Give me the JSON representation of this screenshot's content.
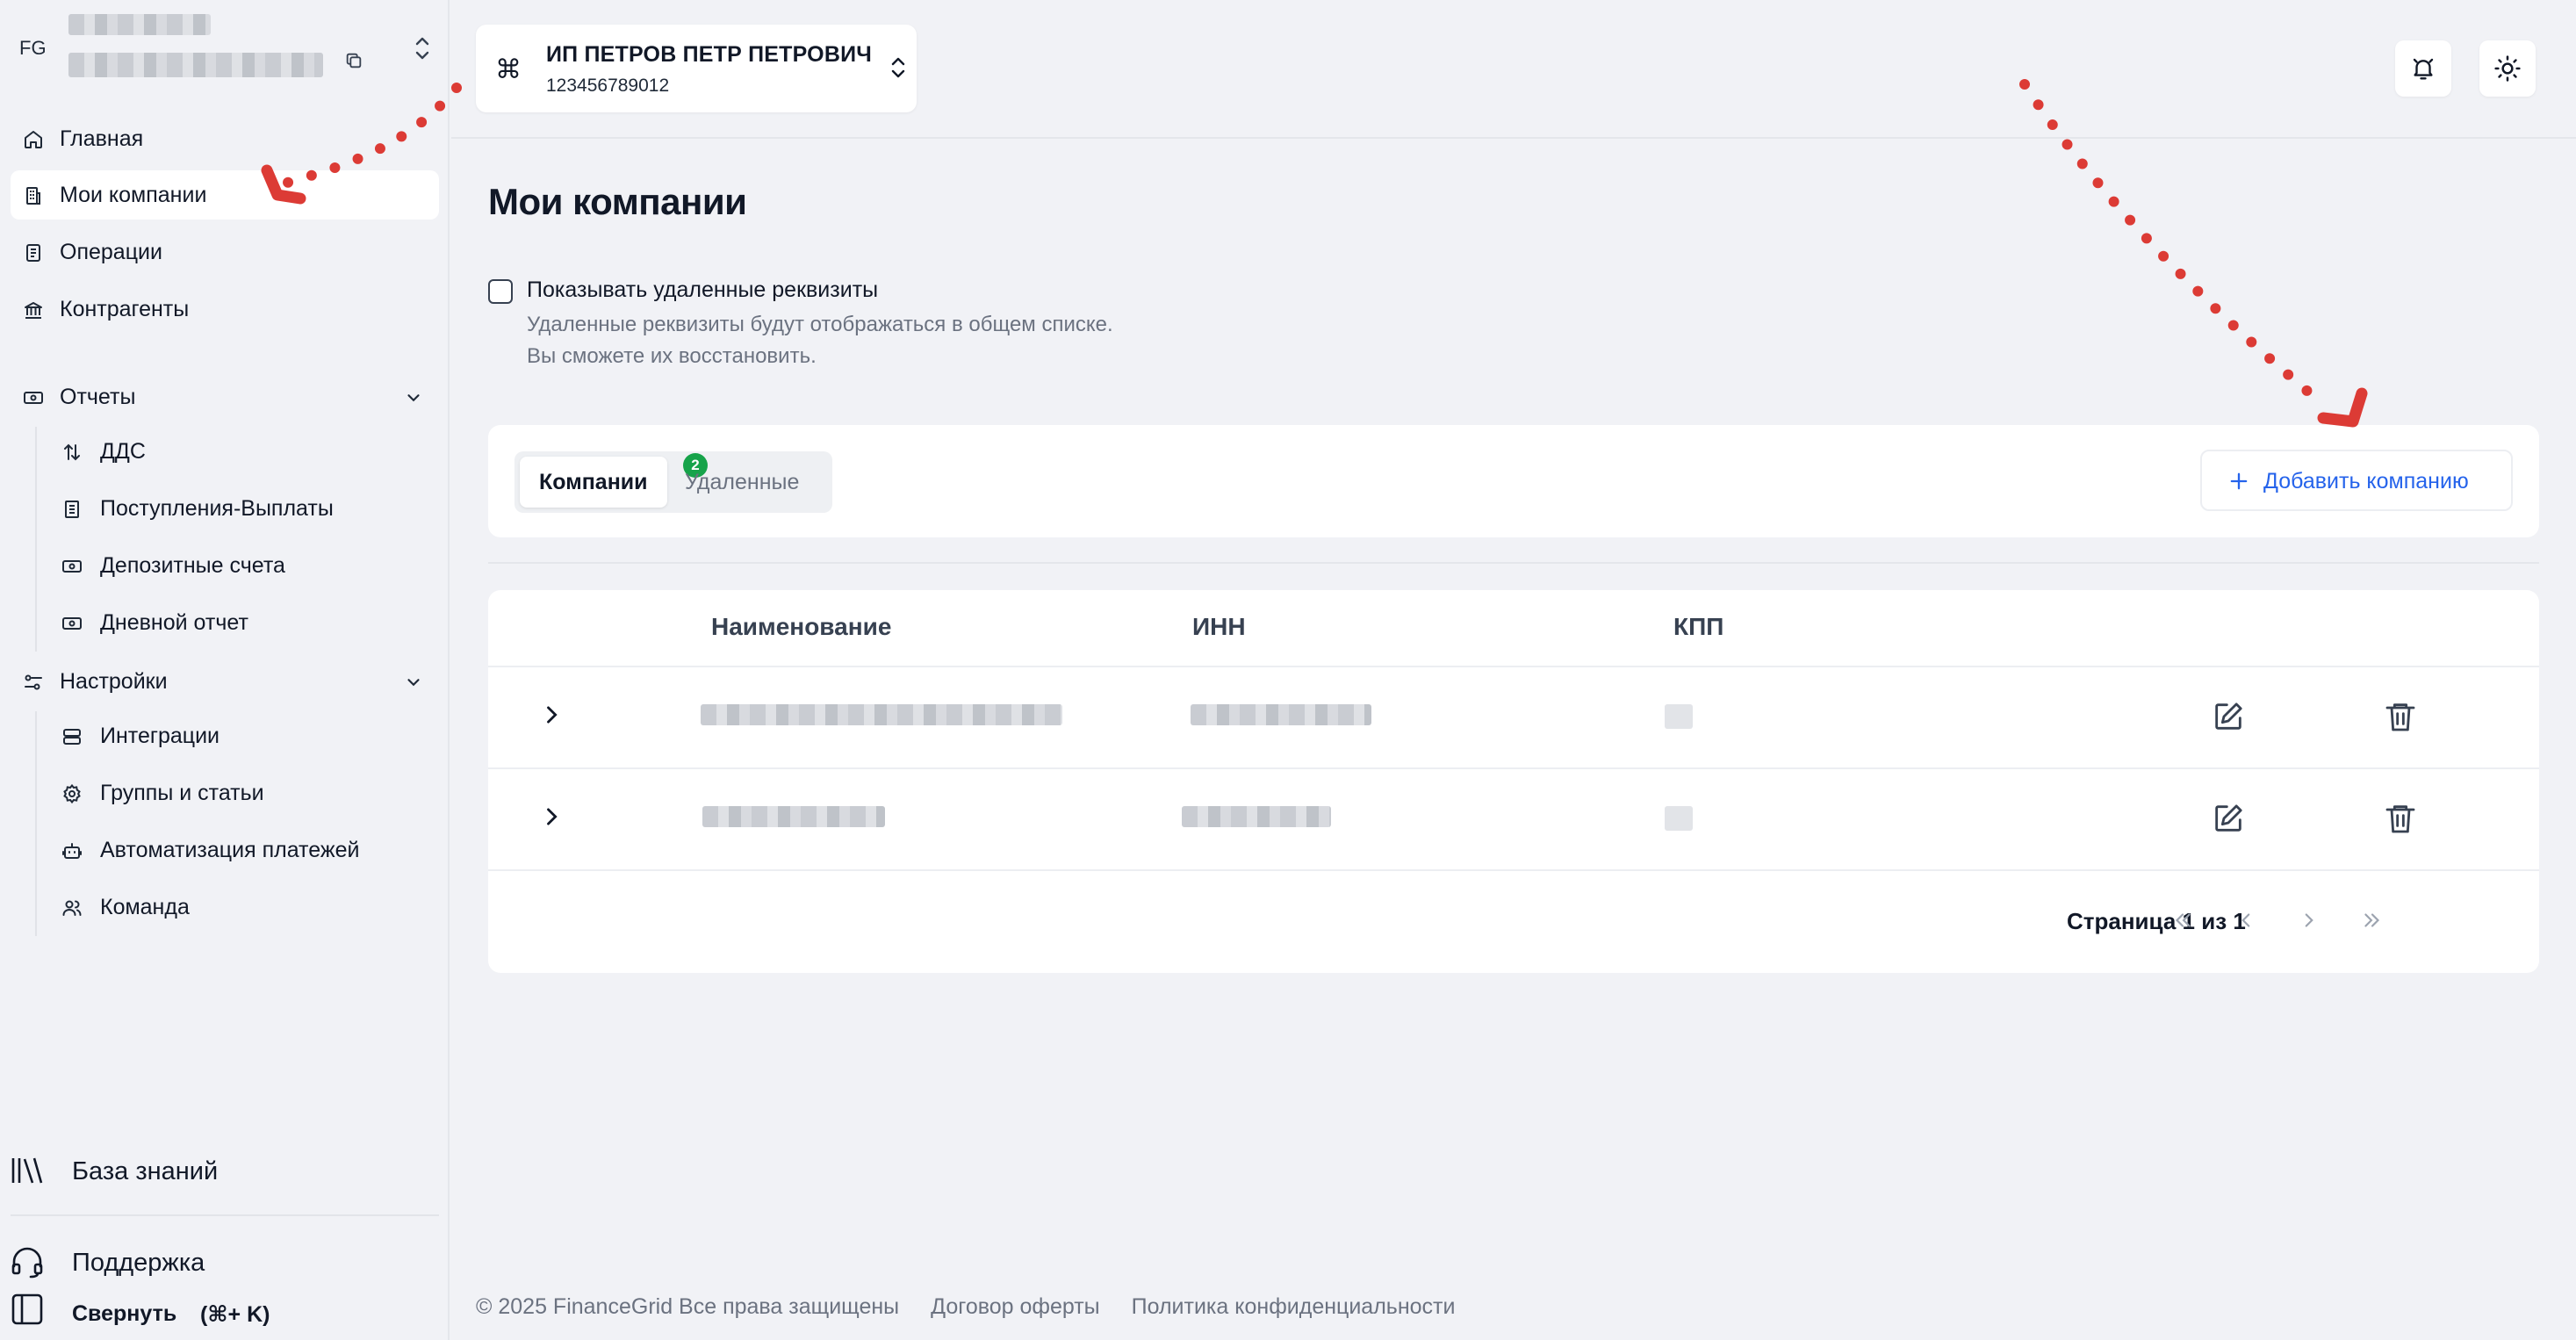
{
  "workspace": {
    "initials": "FG"
  },
  "sidebar": {
    "main_items": [
      {
        "label": "Главная",
        "icon": "home-icon"
      },
      {
        "label": "Мои компании",
        "icon": "building-icon",
        "active": true
      },
      {
        "label": "Операции",
        "icon": "document-list-icon"
      },
      {
        "label": "Контрагенты",
        "icon": "bank-icon"
      }
    ],
    "reports": {
      "label": "Отчеты",
      "icon": "banknote-icon",
      "items": [
        {
          "label": "ДДС",
          "icon": "arrows-updown-icon"
        },
        {
          "label": "Поступления-Выплаты",
          "icon": "receipt-icon"
        },
        {
          "label": "Депозитные счета",
          "icon": "banknote-icon"
        },
        {
          "label": "Дневной отчет",
          "icon": "banknote-icon"
        }
      ]
    },
    "settings": {
      "label": "Настройки",
      "icon": "sliders-icon",
      "items": [
        {
          "label": "Интеграции",
          "icon": "server-icon"
        },
        {
          "label": "Группы и статьи",
          "icon": "gear-icon"
        },
        {
          "label": "Автоматизация платежей",
          "icon": "robot-icon"
        },
        {
          "label": "Команда",
          "icon": "users-icon"
        }
      ]
    },
    "bottom": {
      "knowledge_base": "База знаний",
      "support": "Поддержка",
      "collapse": "Свернуть",
      "collapse_shortcut": "(⌘+ K)"
    }
  },
  "org_selector": {
    "icon": "⌘",
    "name": "ИП ПЕТРОВ ПЕТР ПЕТРОВИЧ",
    "inn": "123456789012"
  },
  "page": {
    "title": "Мои компании",
    "show_deleted": {
      "checked": false,
      "label": "Показывать удаленные реквизиты",
      "help_line1": "Удаленные реквизиты будут отображаться в общем списке.",
      "help_line2": "Вы сможете их восстановить."
    },
    "tabs": [
      {
        "label": "Компании",
        "badge": "2",
        "active": true
      },
      {
        "label": "Удаленные",
        "active": false
      }
    ],
    "add_button": "Добавить компанию",
    "table": {
      "columns": [
        "Наименование",
        "ИНН",
        "КПП"
      ],
      "rows": [
        {
          "name": "",
          "inn": "",
          "kpp": ""
        },
        {
          "name": "",
          "inn": "",
          "kpp": ""
        }
      ]
    },
    "pagination": {
      "text": "Страница 1 из 1",
      "current": 1,
      "total": 1
    }
  },
  "footer": {
    "copyright": "© 2025 FinanceGrid Все права защищены",
    "offer": "Договор оферты",
    "privacy": "Политика конфиденциальности"
  },
  "colors": {
    "accent": "#2563eb",
    "badge": "#16a34a",
    "annotation_arrows": "#dc3b35",
    "background": "#f1f2f6"
  }
}
